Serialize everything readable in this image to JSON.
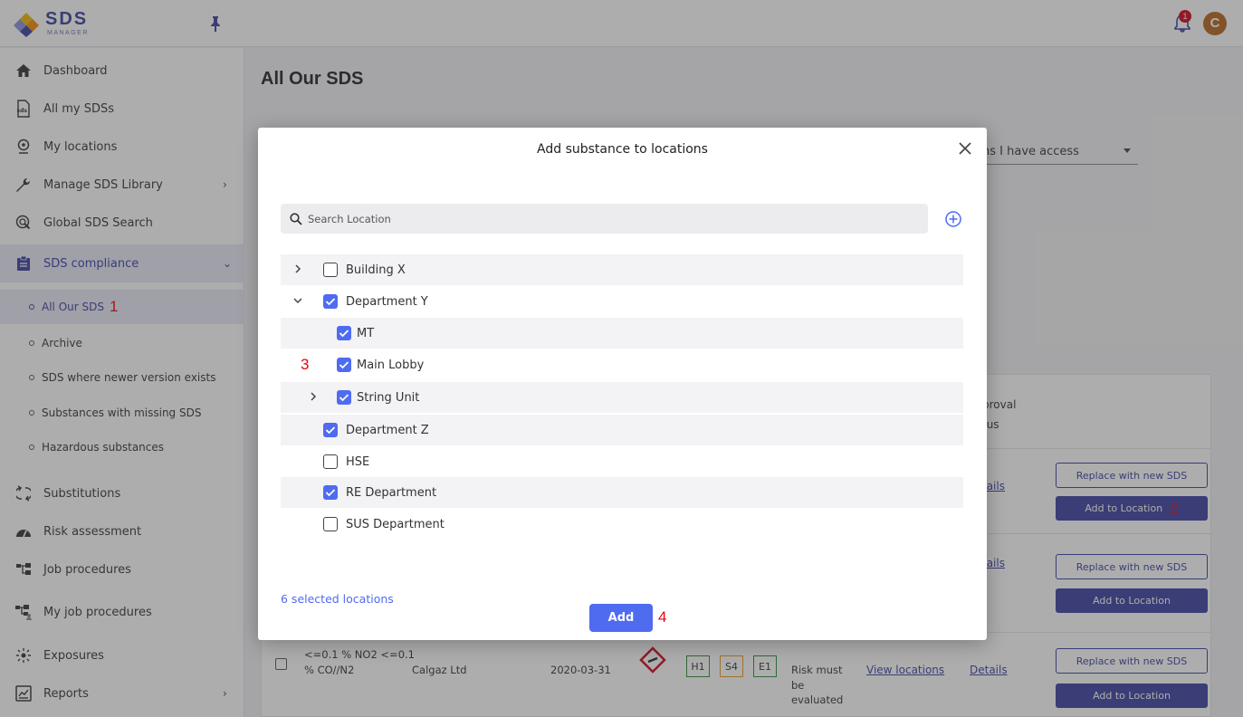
{
  "header": {
    "brand": "SDS",
    "brand_sub": "MANAGER",
    "notification_count": "1",
    "avatar_initial": "C",
    "accent": "#3a3fa0"
  },
  "sidebar": {
    "items": [
      {
        "label": "Dashboard"
      },
      {
        "label": "All my SDSs"
      },
      {
        "label": "My locations"
      },
      {
        "label": "Manage SDS Library"
      },
      {
        "label": "Global SDS Search"
      },
      {
        "label": "SDS compliance"
      },
      {
        "label": "Substitutions"
      },
      {
        "label": "Risk assessment"
      },
      {
        "label": "Job procedures"
      },
      {
        "label": "My job procedures"
      },
      {
        "label": "Exposures"
      },
      {
        "label": "Reports"
      }
    ],
    "compliance_sub": [
      {
        "label": "All Our SDS"
      },
      {
        "label": "Archive"
      },
      {
        "label": "SDS where newer version exists"
      },
      {
        "label": "Substances with missing SDS"
      },
      {
        "label": "Hazardous substances"
      }
    ],
    "marker_1": "1"
  },
  "main": {
    "title": "All Our SDS",
    "filter_value": "ns I have access",
    "col_header_line1": "proval",
    "col_header_line2": "tus",
    "details_link": "tails",
    "replace_label": "Replace with new SDS",
    "add_to_location_label": "Add to Location",
    "marker_2": "2",
    "last_row": {
      "name_line1": "<=0.1 % NO2 <=0.1",
      "name_line2": "% CO//N2",
      "supplier": "Calgaz Ltd",
      "date": "2020-03-31",
      "hazards": [
        "H1",
        "S4",
        "E1"
      ],
      "risk_line1": "Risk must",
      "risk_line2": "be",
      "risk_line3": "evaluated",
      "view_locations": "View locations",
      "details": "Details"
    }
  },
  "modal": {
    "title": "Add substance to locations",
    "search_placeholder": "Search Location",
    "locations": [
      {
        "label": "Building X",
        "checked": false
      },
      {
        "label": "Department Y",
        "checked": true
      },
      {
        "label": "MT",
        "checked": true
      },
      {
        "label": "Main Lobby",
        "checked": true
      },
      {
        "label": "String Unit",
        "checked": true
      },
      {
        "label": "Department Z",
        "checked": true
      },
      {
        "label": "HSE",
        "checked": false
      },
      {
        "label": "RE Department",
        "checked": true
      },
      {
        "label": "SUS Department",
        "checked": false
      }
    ],
    "selected_count": "6 selected locations",
    "add_label": "Add",
    "marker_3": "3",
    "marker_4": "4",
    "check_color": "#4f6bf0"
  }
}
